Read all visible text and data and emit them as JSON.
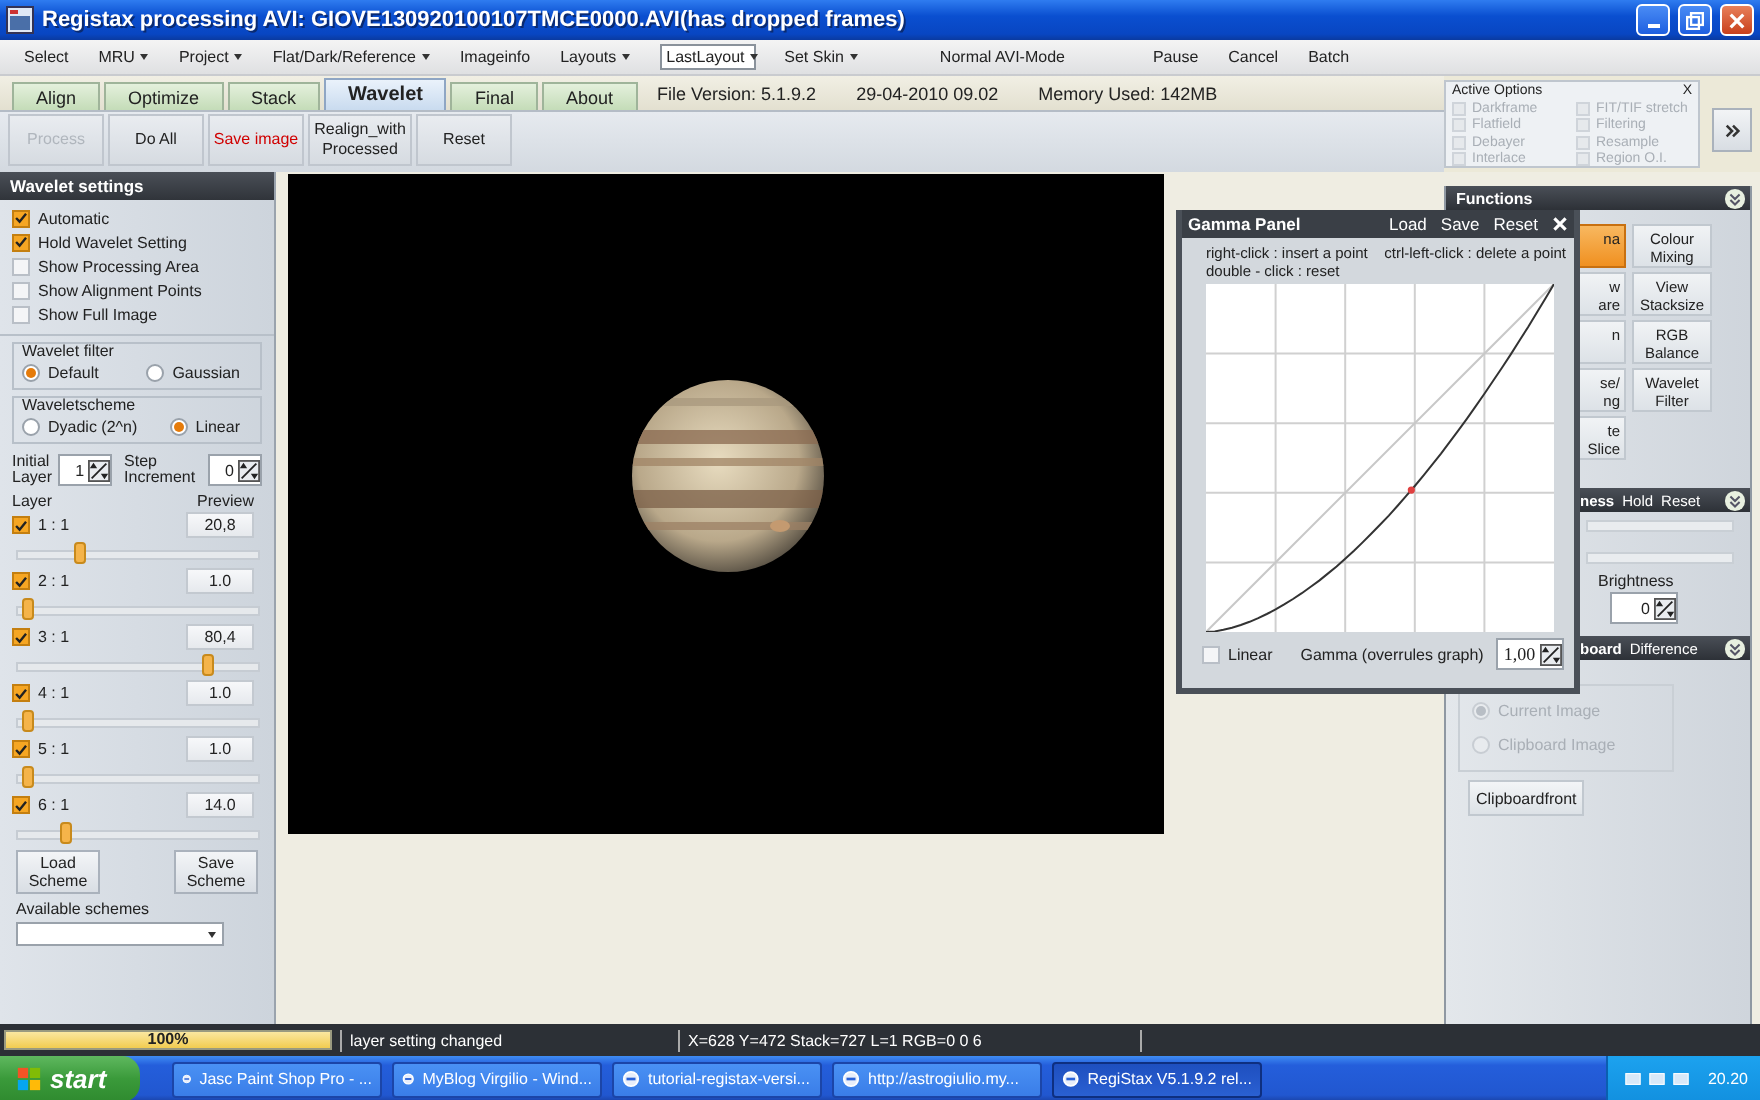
{
  "window": {
    "title": "Registax processing AVI: GIOVE130920100107TMCE0000.AVI(has dropped frames)"
  },
  "menu": [
    {
      "label": "Select",
      "dropdown": false
    },
    {
      "label": "MRU",
      "dropdown": true
    },
    {
      "label": "Project",
      "dropdown": true
    },
    {
      "label": "Flat/Dark/Reference",
      "dropdown": true
    },
    {
      "label": "Imageinfo",
      "dropdown": false
    },
    {
      "label": "Layouts",
      "dropdown": true
    }
  ],
  "layout_select": {
    "value": "LastLayout"
  },
  "menu_right": [
    {
      "label": "Set Skin",
      "dropdown": true
    },
    {
      "label": "Normal AVI-Mode",
      "dropdown": false
    },
    {
      "label": "Pause",
      "dropdown": false
    },
    {
      "label": "Cancel",
      "dropdown": false
    },
    {
      "label": "Batch",
      "dropdown": false
    }
  ],
  "tabs": [
    {
      "label": "Align",
      "selected": false
    },
    {
      "label": "Optimize",
      "selected": false
    },
    {
      "label": "Stack",
      "selected": false
    },
    {
      "label": "Wavelet",
      "selected": true
    },
    {
      "label": "Final",
      "selected": false
    },
    {
      "label": "About",
      "selected": false
    }
  ],
  "info": [
    "File Version: 5.1.9.2",
    "29-04-2010 09.02",
    "Memory Used: 142MB"
  ],
  "toolbar": [
    {
      "label": "Process",
      "kind": "plain",
      "disabled": true
    },
    {
      "label": "Do All",
      "kind": "plain",
      "disabled": false
    },
    {
      "label": "Save image",
      "kind": "alert",
      "disabled": false
    },
    {
      "label": "Realign_with\nProcessed",
      "kind": "plain",
      "disabled": false
    },
    {
      "label": "Reset",
      "kind": "plain",
      "disabled": false
    }
  ],
  "active_options": {
    "title": "Active Options",
    "close": "X",
    "options": [
      {
        "label": "Darkframe",
        "checked": false,
        "disabled": true
      },
      {
        "label": "FIT/TIF stretch",
        "checked": false,
        "disabled": true
      },
      {
        "label": "Flatfield",
        "checked": false,
        "disabled": true
      },
      {
        "label": "Filtering",
        "checked": false,
        "disabled": true
      },
      {
        "label": "Debayer",
        "checked": false,
        "disabled": true
      },
      {
        "label": "Resample",
        "checked": false,
        "disabled": true
      },
      {
        "label": "Interlace",
        "checked": false,
        "disabled": true
      },
      {
        "label": "Region O.I.",
        "checked": false,
        "disabled": true
      }
    ]
  },
  "wavelet_settings": {
    "title": "Wavelet settings",
    "options": [
      {
        "label": "Automatic",
        "checked": true
      },
      {
        "label": "Hold Wavelet Setting",
        "checked": true
      },
      {
        "label": "Show Processing Area",
        "checked": false
      },
      {
        "label": "Show Alignment Points",
        "checked": false
      },
      {
        "label": "Show Full Image",
        "checked": false
      }
    ],
    "filter": {
      "title": "Wavelet filter",
      "options": [
        {
          "label": "Default",
          "selected": true
        },
        {
          "label": "Gaussian",
          "selected": false
        }
      ]
    },
    "scheme": {
      "title": "Waveletscheme",
      "options": [
        {
          "label": "Dyadic (2^n)",
          "selected": false
        },
        {
          "label": "Linear",
          "selected": true
        }
      ]
    },
    "initial_layer": {
      "label": "Initial\nLayer",
      "value": "1"
    },
    "step_increment": {
      "label": "Step\nIncrement",
      "value": "0"
    },
    "layer_heading": "Layer",
    "preview_heading": "Preview",
    "layers": [
      {
        "label": "1 : 1",
        "checked": true,
        "value": "20,8",
        "level": 0.25
      },
      {
        "label": "2 : 1",
        "checked": true,
        "value": "1.0",
        "level": 0.03
      },
      {
        "label": "3 : 1",
        "checked": true,
        "value": "80,4",
        "level": 0.8
      },
      {
        "label": "4 : 1",
        "checked": true,
        "value": "1.0",
        "level": 0.03
      },
      {
        "label": "5 : 1",
        "checked": true,
        "value": "1.0",
        "level": 0.03
      },
      {
        "label": "6 : 1",
        "checked": true,
        "value": "14.0",
        "level": 0.19
      }
    ],
    "buttons": [
      "Load\nScheme",
      "Save\nScheme"
    ],
    "schemes_label": "Available schemes"
  },
  "functions": {
    "title": "Functions",
    "buttons": [
      {
        "label": "na",
        "selected": true
      },
      {
        "label": "Colour\nMixing",
        "selected": false
      },
      {
        "label": "w\nare",
        "selected": false
      },
      {
        "label": "View\nStacksize",
        "selected": false
      },
      {
        "label": "n",
        "selected": false
      },
      {
        "label": "RGB\nBalance",
        "selected": false
      },
      {
        "label": "se/\nng",
        "selected": false
      },
      {
        "label": "Wavelet\nFilter",
        "selected": false
      },
      {
        "label": "te\nSlice",
        "selected": false
      }
    ]
  },
  "brightness_section": {
    "title": "ness",
    "actions": [
      "Hold",
      "Reset"
    ],
    "label": "Brightness",
    "value": "0"
  },
  "clipboard_section": {
    "title": "board",
    "actions": [
      "Difference"
    ],
    "sources": [
      {
        "label": "Current Image",
        "selected": true,
        "disabled": true
      },
      {
        "label": "Clipboard Image",
        "selected": false,
        "disabled": true
      }
    ],
    "button": "Clipboardfront"
  },
  "gamma_panel": {
    "title": "Gamma Panel",
    "actions": [
      "Load",
      "Save",
      "Reset"
    ],
    "hints": [
      "right-click : insert a point",
      "ctrl-left-click : delete a point",
      "double - click : reset"
    ],
    "linear": {
      "label": "Linear",
      "checked": false
    },
    "gamma_label": "Gamma (overrules graph)",
    "gamma_value": "1,00"
  },
  "status_bar": {
    "progress": {
      "label": "100%",
      "level": 1
    },
    "message": "layer setting changed",
    "readout": "X=628 Y=472 Stack=727 L=1 RGB=0 0 6"
  },
  "taskbar": {
    "start": "start",
    "tasks": [
      {
        "label": "Jasc Paint Shop Pro - ...",
        "selected": false
      },
      {
        "label": "MyBlog Virgilio - Wind...",
        "selected": false
      },
      {
        "label": "tutorial-registax-versi...",
        "selected": false
      },
      {
        "label": "http://astrogiulio.my...",
        "selected": false
      },
      {
        "label": "RegiStax V5.1.9.2 rel...",
        "selected": true
      }
    ],
    "clock": "20.20"
  }
}
